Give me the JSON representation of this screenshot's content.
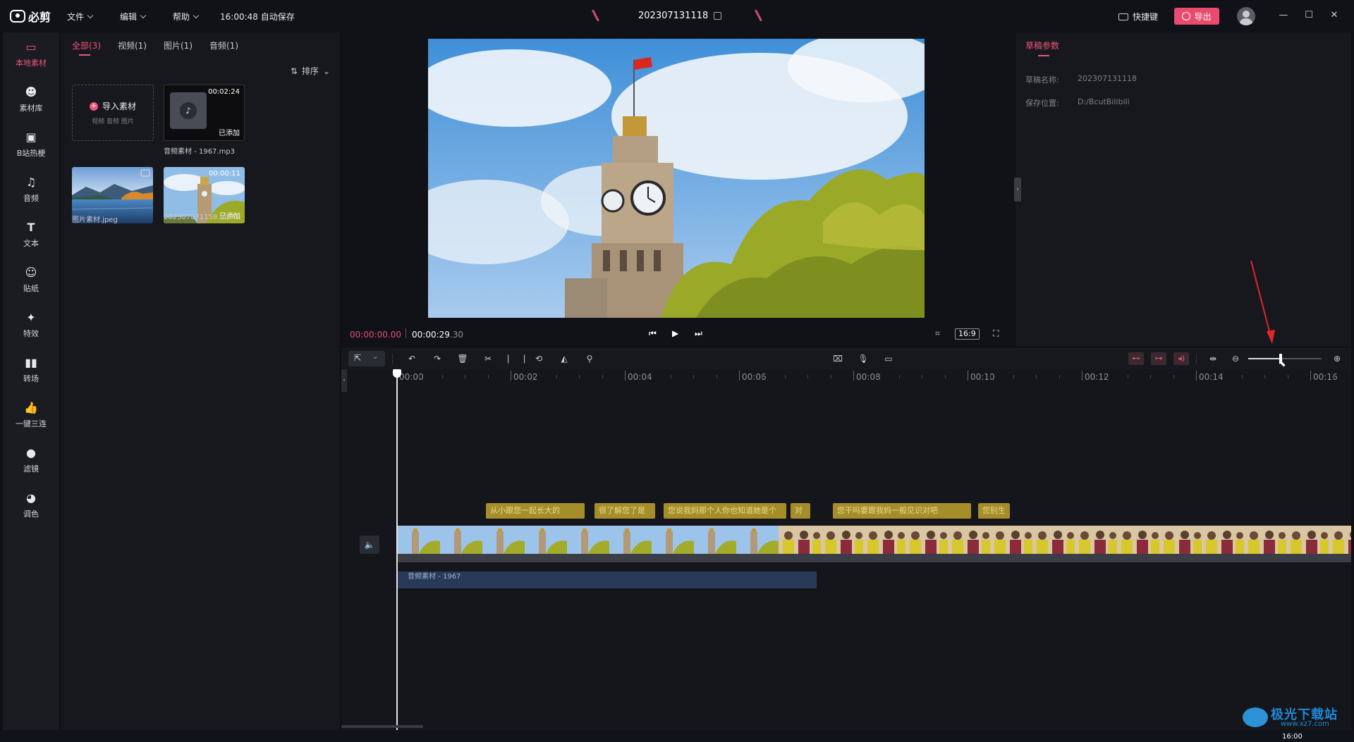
{
  "app": {
    "logo_text": "必剪",
    "menus": [
      "文件",
      "编辑",
      "帮助"
    ],
    "autosave": "16:00:48 自动保存",
    "project_title": "202307131118",
    "shortcut_label": "快捷键",
    "export_label": "导出"
  },
  "sidebar": {
    "items": [
      {
        "label": "本地素材",
        "icon": "folder-icon",
        "active": true
      },
      {
        "label": "素材库",
        "icon": "bilibili-tv-icon"
      },
      {
        "label": "B站热梗",
        "icon": "bilibili-tv-icon"
      },
      {
        "label": "音频",
        "icon": "music-note-icon"
      },
      {
        "label": "文本",
        "icon": "text-t-icon"
      },
      {
        "label": "贴纸",
        "icon": "sticker-icon"
      },
      {
        "label": "特效",
        "icon": "star-effect-icon"
      },
      {
        "label": "转场",
        "icon": "transition-icon"
      },
      {
        "label": "一键三连",
        "icon": "thumbs-up-icon"
      },
      {
        "label": "滤镜",
        "icon": "filter-circles-icon"
      },
      {
        "label": "调色",
        "icon": "palette-icon"
      }
    ]
  },
  "media": {
    "tabs": [
      "全部(3)",
      "视频(1)",
      "图片(1)",
      "音频(1)"
    ],
    "sort_label": "排序",
    "import_label": "导入素材",
    "import_sub": "视频  音频  图片",
    "items": [
      {
        "name": "音频素材 - 1967.mp3",
        "duration": "00:02:24",
        "status": "已添加"
      },
      {
        "name": "图片素材.jpeg",
        "duration": "",
        "status": ""
      },
      {
        "name": "202307071158.mp4",
        "duration": "00:00:11",
        "status": "已添加"
      }
    ]
  },
  "preview": {
    "current_time": "00:00:00.00",
    "total_time": "00:00:29",
    "total_time_frac": ".30",
    "ratio": "16:9"
  },
  "params": {
    "title": "草稿参数",
    "name_label": "草稿名称:",
    "name_value": "202307131118",
    "path_label": "保存位置:",
    "path_value": "D:/BcutBilibili"
  },
  "timeline": {
    "ruler": [
      "00:00",
      "00:02",
      "00:04",
      "00:06",
      "00:08",
      "00:10",
      "00:12",
      "00:14",
      "00:16"
    ],
    "zoom_level": 0.44,
    "subtitles": [
      "从小跟您一起长大的",
      "很了解您了是",
      "您说我妈那个人你也知道她是个",
      "对",
      "您干吗要跟我妈一般见识对吧",
      "您别生"
    ],
    "audio_clip_label": "音频素材 - 1967"
  },
  "watermark": {
    "title": "极光下载站",
    "url": "www.xz7.com"
  },
  "taskbar": {
    "time": "16:00"
  },
  "colors": {
    "accent": "#ef5579",
    "subtitle": "#a58d2a",
    "audio": "#283a58"
  }
}
